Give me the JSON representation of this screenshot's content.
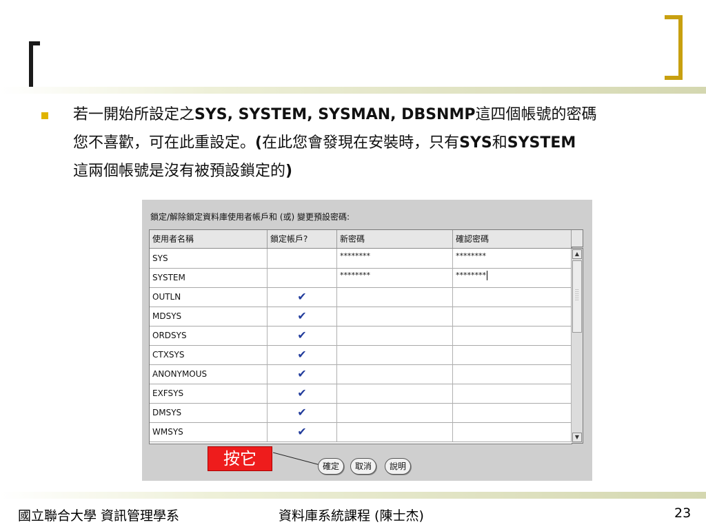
{
  "slide": {
    "bullet_line1": "若一開始所設定之",
    "bullet_line1_bold": "SYS, SYSTEM, SYSMAN, DBSNMP",
    "bullet_line1_end": "這四個帳號的密碼",
    "bullet_line2": "您不喜歡，可在此重設定。",
    "bullet_line2_bold": "(",
    "bullet_line2_mid": "在此您會發現在安裝時，只有",
    "bullet_line2_bold2": "SYS",
    "bullet_line2_mid2": "和",
    "bullet_line2_bold3": "SYSTEM",
    "bullet_line3": "這兩個帳號是沒有被預設鎖定的",
    "bullet_line3_bold": ")",
    "footer_left": "國立聯合大學 資訊管理學系",
    "footer_center": "資料庫系統課程 (陳士杰)",
    "page_number": "23",
    "accent_color": "#c8a010"
  },
  "dialog": {
    "caption": "鎖定/解除鎖定資料庫使用者帳戶和 (或) 變更預設密碼:",
    "columns": [
      "使用者名稱",
      "鎖定帳戶?",
      "新密碼",
      "確認密碼"
    ],
    "rows": [
      {
        "user": "SYS",
        "locked": "",
        "new_pw": "********",
        "confirm_pw": "********"
      },
      {
        "user": "SYSTEM",
        "locked": "",
        "new_pw": "********",
        "confirm_pw": "********"
      },
      {
        "user": "OUTLN",
        "locked": "✔",
        "new_pw": "",
        "confirm_pw": ""
      },
      {
        "user": "MDSYS",
        "locked": "✔",
        "new_pw": "",
        "confirm_pw": ""
      },
      {
        "user": "ORDSYS",
        "locked": "✔",
        "new_pw": "",
        "confirm_pw": ""
      },
      {
        "user": "CTXSYS",
        "locked": "✔",
        "new_pw": "",
        "confirm_pw": ""
      },
      {
        "user": "ANONYMOUS",
        "locked": "✔",
        "new_pw": "",
        "confirm_pw": ""
      },
      {
        "user": "EXFSYS",
        "locked": "✔",
        "new_pw": "",
        "confirm_pw": ""
      },
      {
        "user": "DMSYS",
        "locked": "✔",
        "new_pw": "",
        "confirm_pw": ""
      },
      {
        "user": "WMSYS",
        "locked": "✔",
        "new_pw": "",
        "confirm_pw": ""
      }
    ],
    "ok_label": "確定",
    "cancel_label": "取消",
    "help_label": "說明",
    "callout_label": "按它",
    "callout_color": "#ee1c1c",
    "check_color": "#223c9c"
  }
}
